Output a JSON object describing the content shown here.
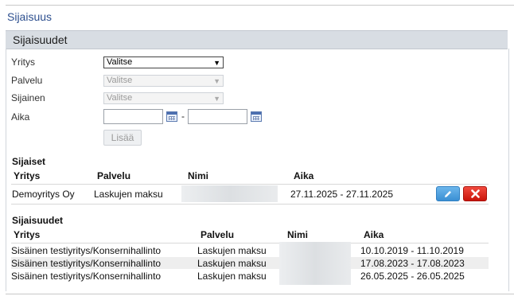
{
  "page": {
    "title": "Sijaisuus"
  },
  "panel": {
    "title": "Sijaisuudet"
  },
  "form": {
    "company_label": "Yritys",
    "company_value": "Valitse",
    "service_label": "Palvelu",
    "service_value": "Valitse",
    "location_label": "Sijainen",
    "location_value": "Valitse",
    "time_label": "Aika",
    "date_separator": "-",
    "add_button": "Lisää"
  },
  "substitutes": {
    "title": "Sijaiset",
    "headers": [
      "Yritys",
      "Palvelu",
      "Nimi",
      "Aika"
    ],
    "rows": [
      {
        "company": "Demoyritys Oy",
        "service": "Laskujen maksu",
        "name": "",
        "time": "27.11.2025 - 27.11.2025"
      }
    ]
  },
  "substitutions": {
    "title": "Sijaisuudet",
    "headers": [
      "Yritys",
      "Palvelu",
      "Nimi",
      "Aika"
    ],
    "rows": [
      {
        "company": "Sisäinen testiyritys/Konsernihallinto",
        "service": "Laskujen maksu",
        "name": "",
        "time": "10.10.2019 - 11.10.2019"
      },
      {
        "company": "Sisäinen testiyritys/Konsernihallinto",
        "service": "Laskujen maksu",
        "name": "",
        "time": "17.08.2023 - 17.08.2023"
      },
      {
        "company": "Sisäinen testiyritys/Konsernihallinto",
        "service": "Laskujen maksu",
        "name": "",
        "time": "26.05.2025 - 26.05.2025"
      }
    ]
  },
  "icons": {
    "edit": "pencil-icon",
    "delete": "close-icon"
  },
  "colors": {
    "header_bg": "#d8dde3",
    "title": "#2d4f8f",
    "edit": "#3a8fd3",
    "delete": "#c9140a"
  }
}
